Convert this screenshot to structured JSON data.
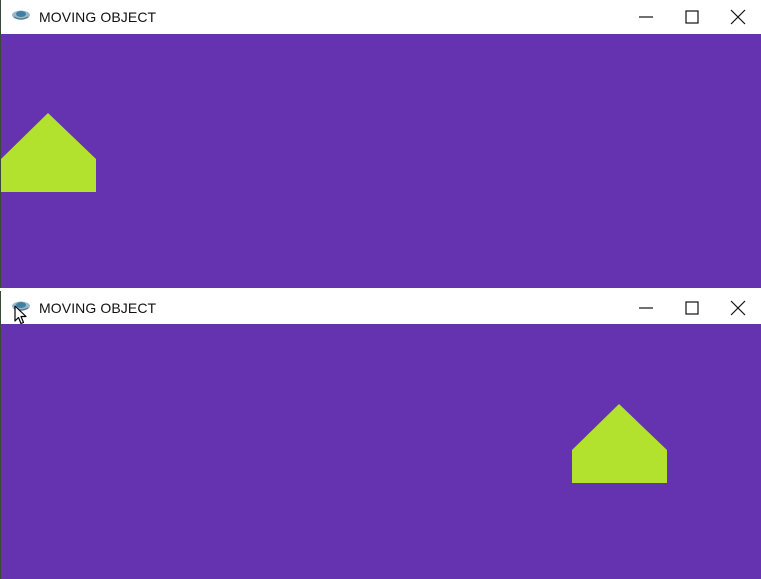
{
  "windows": [
    {
      "title": "MOVING OBJECT",
      "icon": "app-icon",
      "controls": [
        "minimize-icon",
        "maximize-icon",
        "close-icon"
      ],
      "background_color": "#6633b0",
      "shape_color": "#b2e22e"
    },
    {
      "title": "MOVING OBJECT",
      "icon": "app-icon",
      "controls": [
        "minimize-icon",
        "maximize-icon",
        "close-icon"
      ],
      "background_color": "#6633b0",
      "shape_color": "#b2e22e"
    }
  ],
  "cursor": "arrow-cursor-icon"
}
